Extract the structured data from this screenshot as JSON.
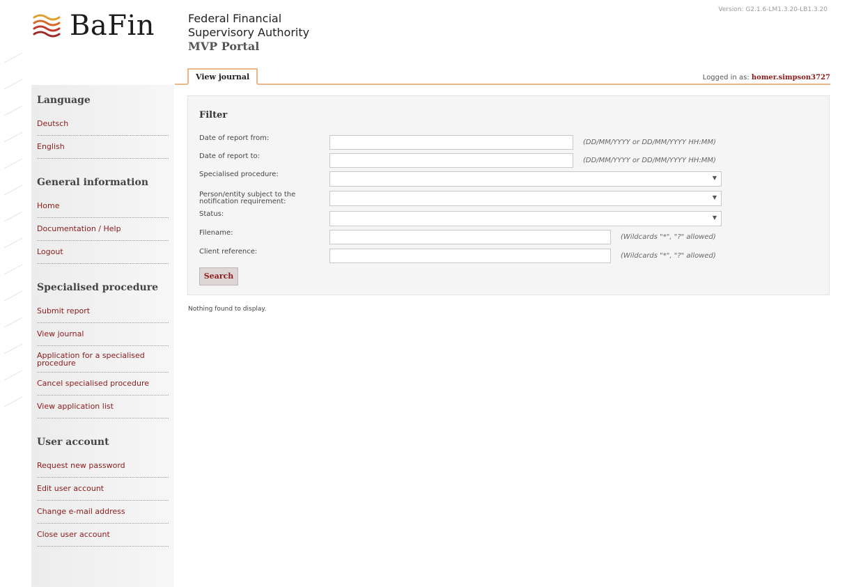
{
  "header": {
    "logo_text": "BaFin",
    "authority_line1": "Federal Financial",
    "authority_line2": "Supervisory Authority",
    "portal_name": "MVP Portal",
    "version": "Version: G2.1.6-LM1.3.20-LB1.3.20"
  },
  "tabs": [
    {
      "label": "View journal"
    }
  ],
  "user": {
    "logged_in_label": "Logged in as:",
    "username": "homer.simpson3727"
  },
  "sidebar": {
    "language": {
      "heading": "Language",
      "items": [
        "Deutsch",
        "English"
      ]
    },
    "general": {
      "heading": "General information",
      "items": [
        "Home",
        "Documentation / Help",
        "Logout"
      ]
    },
    "procedure": {
      "heading": "Specialised procedure",
      "items": [
        "Submit report",
        "View journal",
        "Application for a specialised procedure",
        "Cancel specialised procedure",
        "View application list"
      ]
    },
    "account": {
      "heading": "User account",
      "items": [
        "Request new password",
        "Edit user account",
        "Change e-mail address",
        "Close user account"
      ]
    }
  },
  "filter": {
    "title": "Filter",
    "date_from_label": "Date of report from:",
    "date_from_value": "",
    "date_to_label": "Date of report to:",
    "date_to_value": "",
    "date_hint": "(DD/MM/YYYY or DD/MM/YYYY HH:MM)",
    "procedure_label": "Specialised procedure:",
    "procedure_value": "",
    "person_label": "Person/entity subject to the notification requirement:",
    "person_value": "",
    "status_label": "Status:",
    "status_value": "",
    "filename_label": "Filename:",
    "filename_value": "",
    "client_label": "Client reference:",
    "client_value": "",
    "wildcard_hint": "(Wildcards \"*\", \"?\" allowed)",
    "search_label": "Search"
  },
  "results": {
    "empty_message": "Nothing found to display."
  },
  "colors": {
    "accent": "#8b1a1a",
    "tab_border": "#e8b88a",
    "logo_red": "#c0392b",
    "logo_gold": "#e0a030"
  }
}
